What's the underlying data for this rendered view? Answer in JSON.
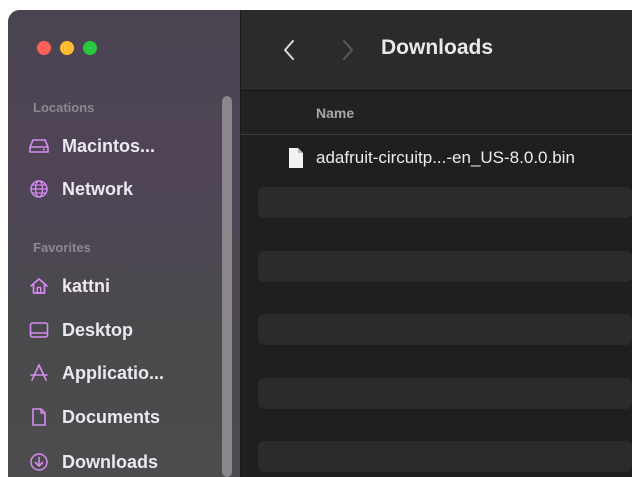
{
  "window": {
    "title": "Downloads"
  },
  "sidebar": {
    "locations_label": "Locations",
    "locations": [
      {
        "label": "Macintos...",
        "icon": "disk-icon"
      },
      {
        "label": "Network",
        "icon": "globe-icon"
      }
    ],
    "favorites_label": "Favorites",
    "favorites": [
      {
        "label": "kattni",
        "icon": "home-icon"
      },
      {
        "label": "Desktop",
        "icon": "desktop-icon"
      },
      {
        "label": "Applicatio...",
        "icon": "applications-icon"
      },
      {
        "label": "Documents",
        "icon": "document-icon"
      },
      {
        "label": "Downloads",
        "icon": "download-icon"
      }
    ]
  },
  "list": {
    "column_name": "Name",
    "files": [
      {
        "name": "adafruit-circuitp...-en_US-8.0.0.bin",
        "icon": "file-icon"
      }
    ]
  },
  "colors": {
    "close": "#ff5f57",
    "minimize": "#febc2e",
    "maximize": "#28c840",
    "accent_icon": "#d58cf0"
  }
}
